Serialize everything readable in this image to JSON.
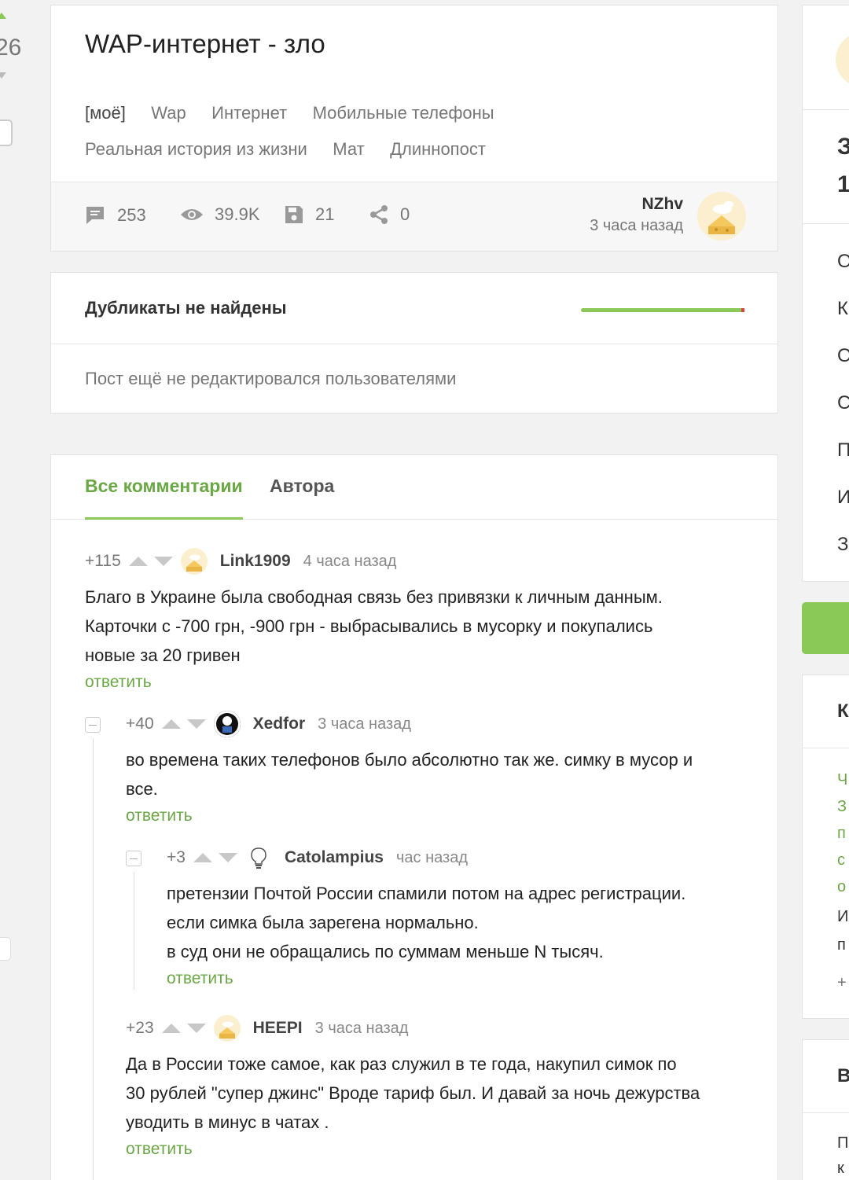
{
  "left": {
    "rating": "26"
  },
  "post": {
    "title": "WAP-интернет - зло",
    "tags": [
      "[моё]",
      "Wap",
      "Интернет",
      "Мобильные телефоны",
      "Реальная история из жизни",
      "Мат",
      "Длиннопост"
    ],
    "stats": {
      "comments": "253",
      "views": "39.9K",
      "saves": "21",
      "shares": "0"
    },
    "author": {
      "name": "NZhv",
      "time": "3 часа назад"
    }
  },
  "duplicates": {
    "title": "Дубликаты не найдены",
    "edit_note": "Пост ещё не редактировался пользователями"
  },
  "comments_section": {
    "tabs": [
      "Все комментарии",
      "Автора"
    ],
    "reply_label": "ответить",
    "comments": [
      {
        "rating": "+115",
        "user": "Link1909",
        "time": "4 часа назад",
        "lines": [
          "Благо в Украине была свободная связь без привязки к личным данным.",
          "Карточки с -700 грн, -900 грн - выбрасывались в мусорку и покупались",
          "новые за 20 гривен"
        ]
      },
      {
        "rating": "+40",
        "user": "Xedfor",
        "time": "3 часа назад",
        "lines": [
          "во времена таких телефонов было абсолютно так же. симку в мусор и",
          "все."
        ]
      },
      {
        "rating": "+3",
        "user": "Catolampius",
        "time": "час назад",
        "lines": [
          "претензии Почтой России спамили потом на адрес регистрации.",
          "если симка была зарегена нормально.",
          "в суд они не обращались по суммам меньше N тысяч."
        ]
      },
      {
        "rating": "+23",
        "user": "HEEPI",
        "time": "3 часа назад",
        "lines": [
          "Да в России тоже самое, как раз служил в те года, накупил симок по",
          "30 рублей \"супер джинс\" Вроде тариф был. И давай за ночь дежурства",
          "уводить в минус в чатах ."
        ]
      }
    ]
  },
  "right": {
    "letters_a": [
      "З",
      "1"
    ],
    "letters_b": [
      "О",
      "К",
      "О",
      "С",
      "П",
      "И",
      "З"
    ],
    "letter_c": "К",
    "links": [
      "Ч",
      "З",
      "п",
      "с",
      "о"
    ],
    "plain": [
      "И",
      "п",
      "+"
    ],
    "letter_d": "В",
    "plain_bottom": [
      "П",
      "к"
    ]
  },
  "colors": {
    "accent": "#8ac858",
    "accent_text": "#6aa843"
  }
}
